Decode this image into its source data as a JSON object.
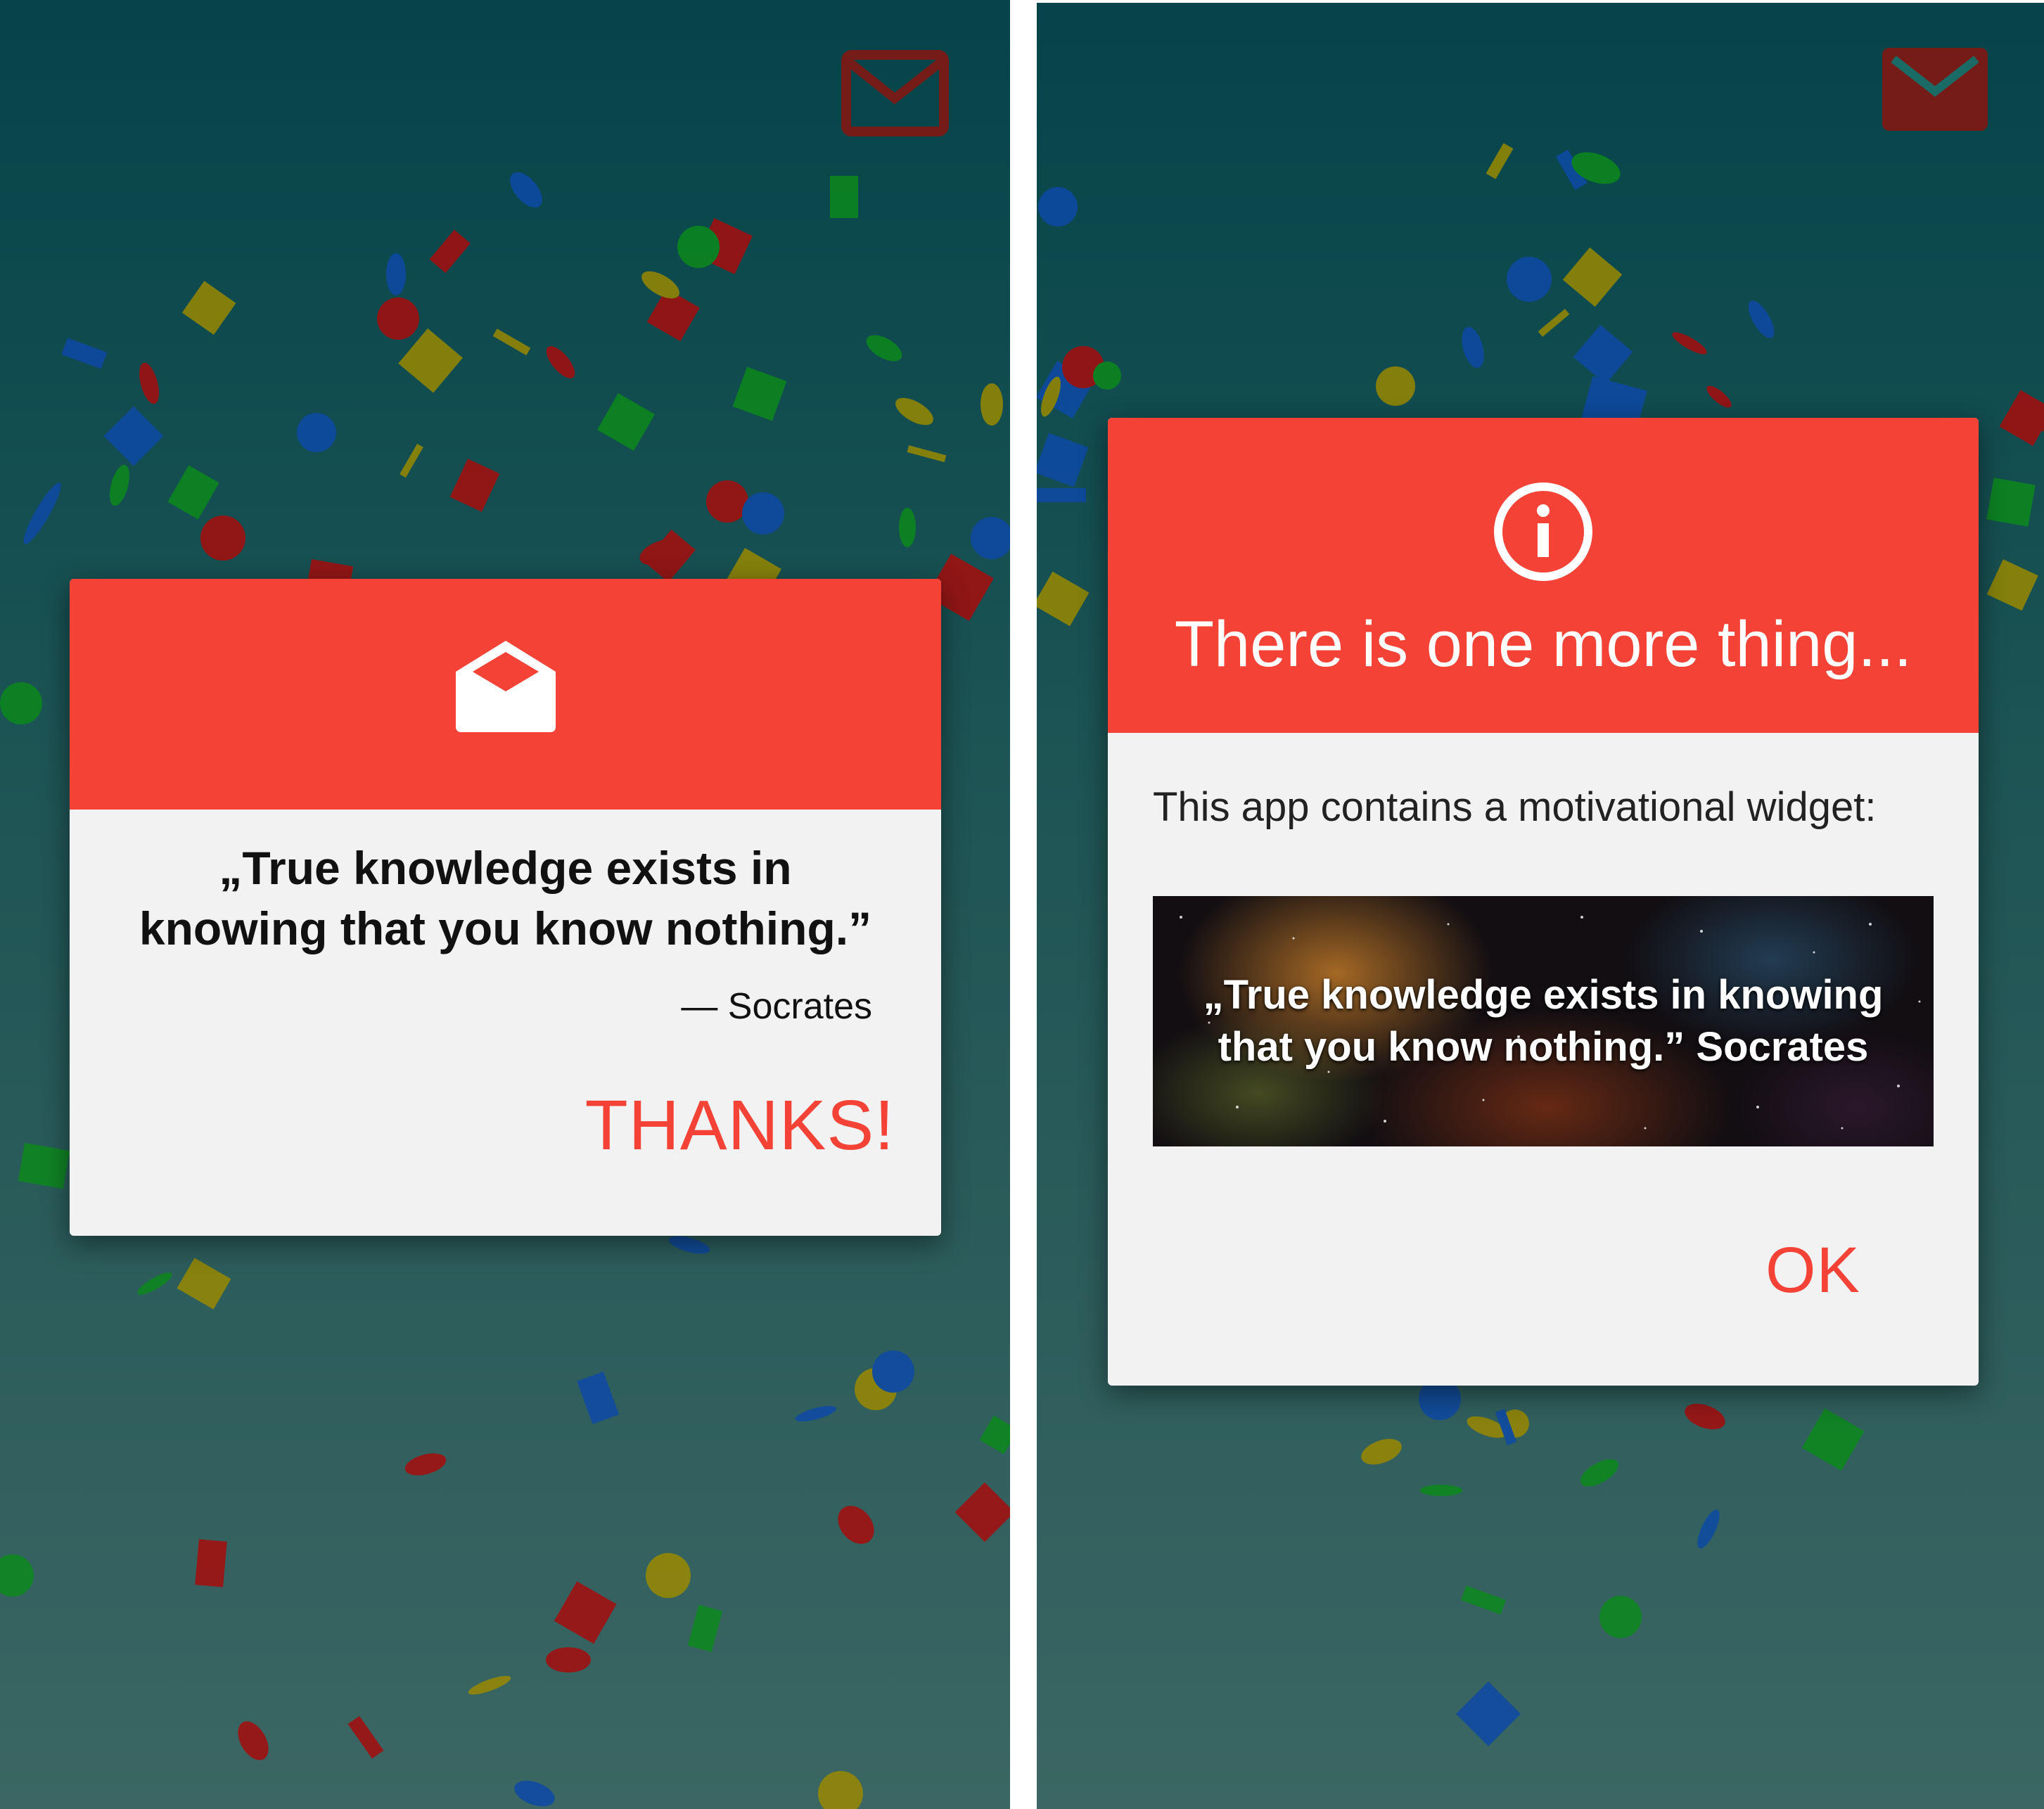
{
  "left_screen": {
    "dialog": {
      "icon": "open-envelope-icon",
      "quote": "„True knowledge exists in knowing that you know nothing.”",
      "author": "— Socrates",
      "button_label": "THANKS!"
    },
    "top_icon": "mail-icon"
  },
  "right_screen": {
    "dialog": {
      "icon": "info-icon",
      "title": "There is one more thing...",
      "body": "This app contains a motivational widget:",
      "widget_quote": "„True knowledge exists in knowing that you know nothing.” Socrates",
      "button_label": "OK"
    },
    "top_icon": "mail-icon"
  },
  "colors": {
    "accent": "#f44336",
    "dialog_background": "#f2f2f2",
    "background_top": "#04444a",
    "background_bottom": "#3b6663"
  }
}
